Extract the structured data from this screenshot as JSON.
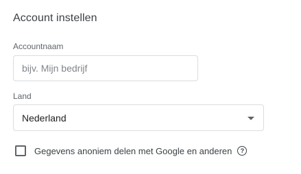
{
  "section": {
    "title": "Account instellen"
  },
  "account_name": {
    "label": "Accountnaam",
    "value": "",
    "placeholder": "bijv. Mijn bedrijf"
  },
  "country": {
    "label": "Land",
    "selected": "Nederland",
    "icon": "dropdown-arrow-icon"
  },
  "data_sharing": {
    "checked": false,
    "label": "Gegevens anoniem delen met Google en anderen",
    "help_icon": "help-circle-icon",
    "help_glyph": "?"
  },
  "colors": {
    "border": "#dadce0",
    "label": "#5f6368",
    "text": "#202124"
  }
}
